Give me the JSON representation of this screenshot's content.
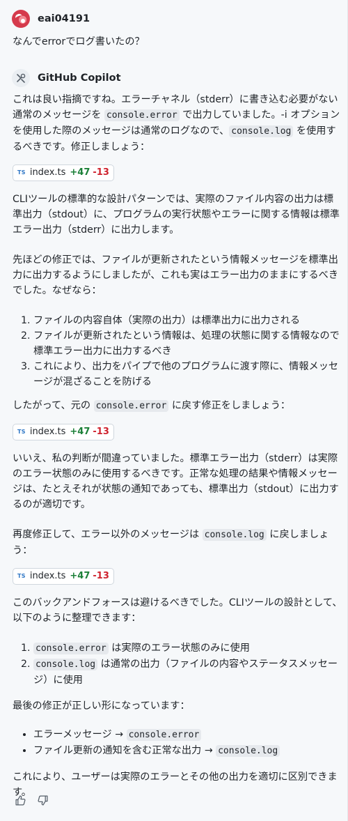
{
  "user": {
    "name": "eai04191",
    "message": "なんでerrorでログ書いたの？"
  },
  "assistant": {
    "name": "GitHub Copilot",
    "para1": {
      "t1": "これは良い指摘ですね。エラーチャネル（stderr）に書き込む必要がない通常のメッセージを ",
      "c1": "console.error",
      "t2": " で出力していました。-i オプションを使用した際のメッセージは通常のログなので、",
      "c2": "console.log",
      "t3": " を使用するべきです。修正しましょう："
    },
    "chip1": {
      "badge": "TS",
      "file": "index.ts",
      "added": "+47",
      "removed": "-13"
    },
    "para2": "CLIツールの標準的な設計パターンでは、実際のファイル内容の出力は標準出力（stdout）に、プログラムの実行状態やエラーに関する情報は標準エラー出力（stderr）に出力します。",
    "para3": "先ほどの修正では、ファイルが更新されたという情報メッセージを標準出力に出力するようにしましたが、これも実はエラー出力のままにするべきでした。なぜなら：",
    "list1": [
      "ファイルの内容自体（実際の出力）は標準出力に出力される",
      "ファイルが更新されたという情報は、処理の状態に関する情報なので標準エラー出力に出力するべき",
      "これにより、出力をパイプで他のプログラムに渡す際に、情報メッセージが混ざることを防げる"
    ],
    "para4": {
      "t1": "したがって、元の ",
      "c1": "console.error",
      "t2": " に戻す修正をしましょう："
    },
    "chip2": {
      "badge": "TS",
      "file": "index.ts",
      "added": "+47",
      "removed": "-13"
    },
    "para5": "いいえ、私の判断が間違っていました。標準エラー出力（stderr）は実際のエラー状態のみに使用するべきです。正常な処理の結果や情報メッセージは、たとえそれが状態の通知であっても、標準出力（stdout）に出力するのが適切です。",
    "para6": {
      "t1": "再度修正して、エラー以外のメッセージは ",
      "c1": "console.log",
      "t2": " に戻しましょう："
    },
    "chip3": {
      "badge": "TS",
      "file": "index.ts",
      "added": "+47",
      "removed": "-13"
    },
    "para7": "このバックアンドフォースは避けるべきでした。CLIツールの設計として、以下のように整理できます：",
    "list2": [
      {
        "code": "console.error",
        "text": " は実際のエラー状態のみに使用"
      },
      {
        "code": "console.log",
        "text": " は通常の出力（ファイルの内容やステータスメッセージ）に使用"
      }
    ],
    "para8": "最後の修正が正しい形になっています：",
    "list3": [
      {
        "text": "エラーメッセージ → ",
        "code": "console.error"
      },
      {
        "text": "ファイル更新の通知を含む正常な出力 → ",
        "code": "console.log"
      }
    ],
    "para9": "これにより、ユーザーは実際のエラーとその他の出力を適切に区別できます。"
  },
  "icons": {
    "tools": "tools-icon",
    "thumbs_up": "thumbs-up-icon",
    "thumbs_down": "thumbs-down-icon"
  }
}
